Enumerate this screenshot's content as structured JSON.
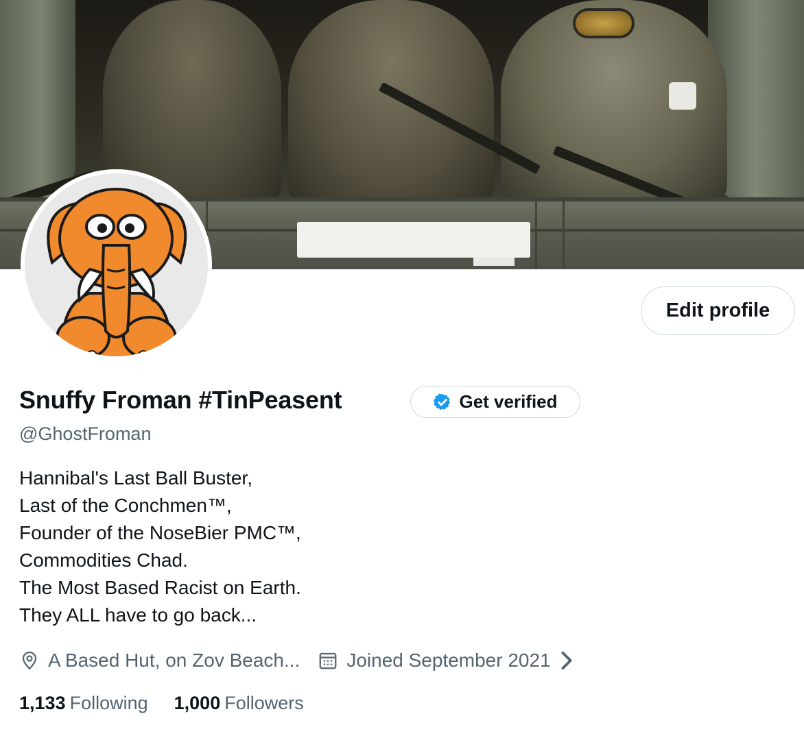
{
  "profile": {
    "display_name": "Snuffy Froman #TinPeasent",
    "handle": "@GhostFroman",
    "verify_label": "Get verified",
    "edit_label": "Edit profile",
    "bio_lines": [
      "Hannibal's Last Ball Buster,",
      "Last of the Conchmen™,",
      "Founder of the NoseBier PMC™,",
      "Commodities Chad.",
      "The Most Based Racist on Earth.",
      "They ALL have to go back..."
    ],
    "location": "A Based Hut, on Zov Beach...",
    "joined": "Joined September 2021",
    "following_count": "1,133",
    "following_label": "Following",
    "followers_count": "1,000",
    "followers_label": "Followers"
  },
  "icons": {
    "location": "location-pin-icon",
    "calendar": "calendar-icon",
    "verified": "verified-badge-icon",
    "chevron": "chevron-right-icon"
  },
  "colors": {
    "text_primary": "#0f1419",
    "text_secondary": "#536471",
    "border": "#cfd9de",
    "verified_blue": "#1d9bf0",
    "avatar_orange": "#f08a2c"
  }
}
